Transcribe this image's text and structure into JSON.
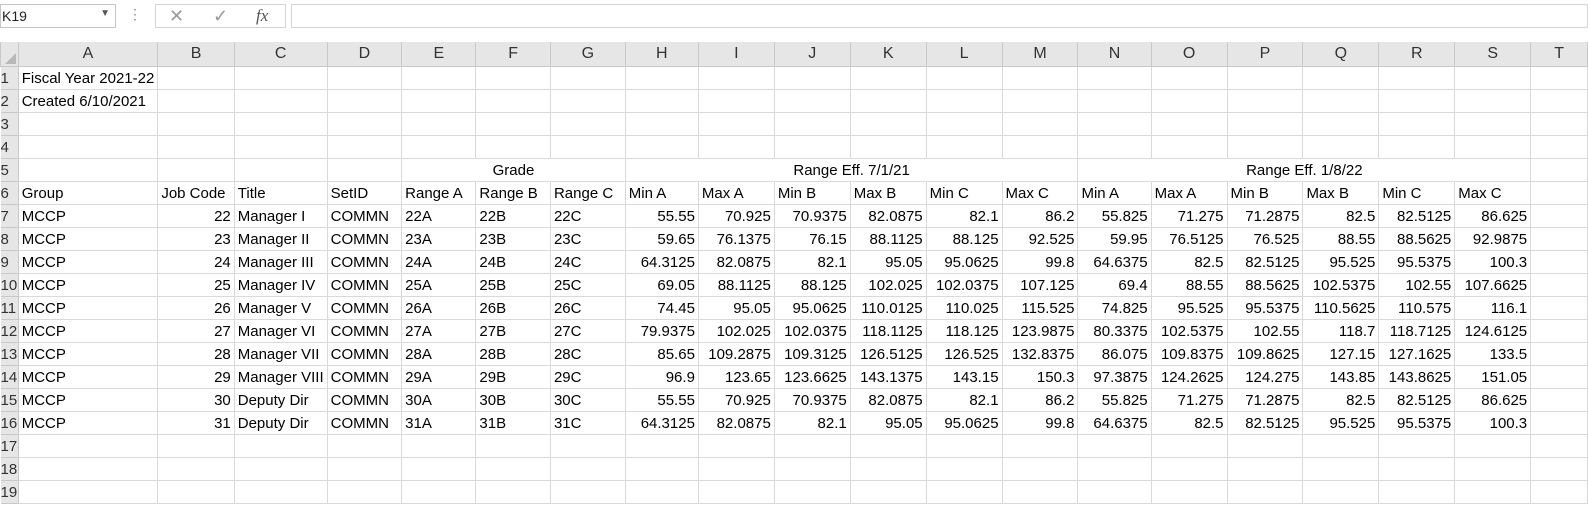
{
  "formula_bar": {
    "name_box": "K19",
    "cancel_glyph": "✕",
    "enter_glyph": "✓",
    "fx_label": "fx",
    "formula_value": ""
  },
  "columns": [
    "A",
    "B",
    "C",
    "D",
    "E",
    "F",
    "G",
    "H",
    "I",
    "J",
    "K",
    "L",
    "M",
    "N",
    "O",
    "P",
    "Q",
    "R",
    "S",
    "T"
  ],
  "rows": [
    {
      "num": "1",
      "cells": [
        {
          "col": "A",
          "text": "Fiscal Year 2021-22"
        }
      ]
    },
    {
      "num": "2",
      "cells": [
        {
          "col": "A",
          "text": "Created 6/10/2021"
        }
      ]
    },
    {
      "num": "3",
      "cells": []
    },
    {
      "num": "4",
      "cells": []
    },
    {
      "num": "5",
      "cells": [
        {
          "col": "E",
          "text": "Grade",
          "span": 3,
          "align": "ctr"
        },
        {
          "col": "H",
          "text": "Range Eff. 7/1/21",
          "span": 6,
          "align": "ctr"
        },
        {
          "col": "N",
          "text": "Range Eff. 1/8/22",
          "span": 6,
          "align": "ctr"
        }
      ]
    },
    {
      "num": "6",
      "cells": [
        {
          "col": "A",
          "text": "Group"
        },
        {
          "col": "B",
          "text": "Job Code"
        },
        {
          "col": "C",
          "text": "Title"
        },
        {
          "col": "D",
          "text": "SetID"
        },
        {
          "col": "E",
          "text": "Range A"
        },
        {
          "col": "F",
          "text": "Range B"
        },
        {
          "col": "G",
          "text": "Range C"
        },
        {
          "col": "H",
          "text": "Min A"
        },
        {
          "col": "I",
          "text": "Max A"
        },
        {
          "col": "J",
          "text": "Min B"
        },
        {
          "col": "K",
          "text": "Max B"
        },
        {
          "col": "L",
          "text": "Min C"
        },
        {
          "col": "M",
          "text": "Max C"
        },
        {
          "col": "N",
          "text": "Min A"
        },
        {
          "col": "O",
          "text": "Max A"
        },
        {
          "col": "P",
          "text": "Min B"
        },
        {
          "col": "Q",
          "text": "Max B"
        },
        {
          "col": "R",
          "text": "Min C"
        },
        {
          "col": "S",
          "text": "Max C"
        }
      ]
    },
    {
      "num": "7",
      "cells": [
        {
          "col": "A",
          "text": "MCCP"
        },
        {
          "col": "B",
          "text": "22",
          "align": "num"
        },
        {
          "col": "C",
          "text": "Manager I"
        },
        {
          "col": "D",
          "text": "COMMN"
        },
        {
          "col": "E",
          "text": "22A"
        },
        {
          "col": "F",
          "text": "22B"
        },
        {
          "col": "G",
          "text": "22C"
        },
        {
          "col": "H",
          "text": "55.55",
          "align": "num"
        },
        {
          "col": "I",
          "text": "70.925",
          "align": "num"
        },
        {
          "col": "J",
          "text": "70.9375",
          "align": "num"
        },
        {
          "col": "K",
          "text": "82.0875",
          "align": "num"
        },
        {
          "col": "L",
          "text": "82.1",
          "align": "num"
        },
        {
          "col": "M",
          "text": "86.2",
          "align": "num"
        },
        {
          "col": "N",
          "text": "55.825",
          "align": "num"
        },
        {
          "col": "O",
          "text": "71.275",
          "align": "num"
        },
        {
          "col": "P",
          "text": "71.2875",
          "align": "num"
        },
        {
          "col": "Q",
          "text": "82.5",
          "align": "num"
        },
        {
          "col": "R",
          "text": "82.5125",
          "align": "num"
        },
        {
          "col": "S",
          "text": "86.625",
          "align": "num"
        }
      ]
    },
    {
      "num": "8",
      "cells": [
        {
          "col": "A",
          "text": "MCCP"
        },
        {
          "col": "B",
          "text": "23",
          "align": "num"
        },
        {
          "col": "C",
          "text": "Manager II"
        },
        {
          "col": "D",
          "text": "COMMN"
        },
        {
          "col": "E",
          "text": "23A"
        },
        {
          "col": "F",
          "text": "23B"
        },
        {
          "col": "G",
          "text": "23C"
        },
        {
          "col": "H",
          "text": "59.65",
          "align": "num"
        },
        {
          "col": "I",
          "text": "76.1375",
          "align": "num"
        },
        {
          "col": "J",
          "text": "76.15",
          "align": "num"
        },
        {
          "col": "K",
          "text": "88.1125",
          "align": "num"
        },
        {
          "col": "L",
          "text": "88.125",
          "align": "num"
        },
        {
          "col": "M",
          "text": "92.525",
          "align": "num"
        },
        {
          "col": "N",
          "text": "59.95",
          "align": "num"
        },
        {
          "col": "O",
          "text": "76.5125",
          "align": "num"
        },
        {
          "col": "P",
          "text": "76.525",
          "align": "num"
        },
        {
          "col": "Q",
          "text": "88.55",
          "align": "num"
        },
        {
          "col": "R",
          "text": "88.5625",
          "align": "num"
        },
        {
          "col": "S",
          "text": "92.9875",
          "align": "num"
        }
      ]
    },
    {
      "num": "9",
      "cells": [
        {
          "col": "A",
          "text": "MCCP"
        },
        {
          "col": "B",
          "text": "24",
          "align": "num"
        },
        {
          "col": "C",
          "text": "Manager III"
        },
        {
          "col": "D",
          "text": "COMMN"
        },
        {
          "col": "E",
          "text": "24A"
        },
        {
          "col": "F",
          "text": "24B"
        },
        {
          "col": "G",
          "text": "24C"
        },
        {
          "col": "H",
          "text": "64.3125",
          "align": "num"
        },
        {
          "col": "I",
          "text": "82.0875",
          "align": "num"
        },
        {
          "col": "J",
          "text": "82.1",
          "align": "num"
        },
        {
          "col": "K",
          "text": "95.05",
          "align": "num"
        },
        {
          "col": "L",
          "text": "95.0625",
          "align": "num"
        },
        {
          "col": "M",
          "text": "99.8",
          "align": "num"
        },
        {
          "col": "N",
          "text": "64.6375",
          "align": "num"
        },
        {
          "col": "O",
          "text": "82.5",
          "align": "num"
        },
        {
          "col": "P",
          "text": "82.5125",
          "align": "num"
        },
        {
          "col": "Q",
          "text": "95.525",
          "align": "num"
        },
        {
          "col": "R",
          "text": "95.5375",
          "align": "num"
        },
        {
          "col": "S",
          "text": "100.3",
          "align": "num"
        }
      ]
    },
    {
      "num": "10",
      "cells": [
        {
          "col": "A",
          "text": "MCCP"
        },
        {
          "col": "B",
          "text": "25",
          "align": "num"
        },
        {
          "col": "C",
          "text": "Manager IV"
        },
        {
          "col": "D",
          "text": "COMMN"
        },
        {
          "col": "E",
          "text": "25A"
        },
        {
          "col": "F",
          "text": "25B"
        },
        {
          "col": "G",
          "text": "25C"
        },
        {
          "col": "H",
          "text": "69.05",
          "align": "num"
        },
        {
          "col": "I",
          "text": "88.1125",
          "align": "num"
        },
        {
          "col": "J",
          "text": "88.125",
          "align": "num"
        },
        {
          "col": "K",
          "text": "102.025",
          "align": "num"
        },
        {
          "col": "L",
          "text": "102.0375",
          "align": "num"
        },
        {
          "col": "M",
          "text": "107.125",
          "align": "num"
        },
        {
          "col": "N",
          "text": "69.4",
          "align": "num"
        },
        {
          "col": "O",
          "text": "88.55",
          "align": "num"
        },
        {
          "col": "P",
          "text": "88.5625",
          "align": "num"
        },
        {
          "col": "Q",
          "text": "102.5375",
          "align": "num"
        },
        {
          "col": "R",
          "text": "102.55",
          "align": "num"
        },
        {
          "col": "S",
          "text": "107.6625",
          "align": "num"
        }
      ]
    },
    {
      "num": "11",
      "cells": [
        {
          "col": "A",
          "text": "MCCP"
        },
        {
          "col": "B",
          "text": "26",
          "align": "num"
        },
        {
          "col": "C",
          "text": "Manager V"
        },
        {
          "col": "D",
          "text": "COMMN"
        },
        {
          "col": "E",
          "text": "26A"
        },
        {
          "col": "F",
          "text": "26B"
        },
        {
          "col": "G",
          "text": "26C"
        },
        {
          "col": "H",
          "text": "74.45",
          "align": "num"
        },
        {
          "col": "I",
          "text": "95.05",
          "align": "num"
        },
        {
          "col": "J",
          "text": "95.0625",
          "align": "num"
        },
        {
          "col": "K",
          "text": "110.0125",
          "align": "num"
        },
        {
          "col": "L",
          "text": "110.025",
          "align": "num"
        },
        {
          "col": "M",
          "text": "115.525",
          "align": "num"
        },
        {
          "col": "N",
          "text": "74.825",
          "align": "num"
        },
        {
          "col": "O",
          "text": "95.525",
          "align": "num"
        },
        {
          "col": "P",
          "text": "95.5375",
          "align": "num"
        },
        {
          "col": "Q",
          "text": "110.5625",
          "align": "num"
        },
        {
          "col": "R",
          "text": "110.575",
          "align": "num"
        },
        {
          "col": "S",
          "text": "116.1",
          "align": "num"
        }
      ]
    },
    {
      "num": "12",
      "cells": [
        {
          "col": "A",
          "text": "MCCP"
        },
        {
          "col": "B",
          "text": "27",
          "align": "num"
        },
        {
          "col": "C",
          "text": "Manager VI"
        },
        {
          "col": "D",
          "text": "COMMN"
        },
        {
          "col": "E",
          "text": "27A"
        },
        {
          "col": "F",
          "text": "27B"
        },
        {
          "col": "G",
          "text": "27C"
        },
        {
          "col": "H",
          "text": "79.9375",
          "align": "num"
        },
        {
          "col": "I",
          "text": "102.025",
          "align": "num"
        },
        {
          "col": "J",
          "text": "102.0375",
          "align": "num"
        },
        {
          "col": "K",
          "text": "118.1125",
          "align": "num"
        },
        {
          "col": "L",
          "text": "118.125",
          "align": "num"
        },
        {
          "col": "M",
          "text": "123.9875",
          "align": "num"
        },
        {
          "col": "N",
          "text": "80.3375",
          "align": "num"
        },
        {
          "col": "O",
          "text": "102.5375",
          "align": "num"
        },
        {
          "col": "P",
          "text": "102.55",
          "align": "num"
        },
        {
          "col": "Q",
          "text": "118.7",
          "align": "num"
        },
        {
          "col": "R",
          "text": "118.7125",
          "align": "num"
        },
        {
          "col": "S",
          "text": "124.6125",
          "align": "num"
        }
      ]
    },
    {
      "num": "13",
      "cells": [
        {
          "col": "A",
          "text": "MCCP"
        },
        {
          "col": "B",
          "text": "28",
          "align": "num"
        },
        {
          "col": "C",
          "text": "Manager VII"
        },
        {
          "col": "D",
          "text": "COMMN"
        },
        {
          "col": "E",
          "text": "28A"
        },
        {
          "col": "F",
          "text": "28B"
        },
        {
          "col": "G",
          "text": "28C"
        },
        {
          "col": "H",
          "text": "85.65",
          "align": "num"
        },
        {
          "col": "I",
          "text": "109.2875",
          "align": "num"
        },
        {
          "col": "J",
          "text": "109.3125",
          "align": "num"
        },
        {
          "col": "K",
          "text": "126.5125",
          "align": "num"
        },
        {
          "col": "L",
          "text": "126.525",
          "align": "num"
        },
        {
          "col": "M",
          "text": "132.8375",
          "align": "num"
        },
        {
          "col": "N",
          "text": "86.075",
          "align": "num"
        },
        {
          "col": "O",
          "text": "109.8375",
          "align": "num"
        },
        {
          "col": "P",
          "text": "109.8625",
          "align": "num"
        },
        {
          "col": "Q",
          "text": "127.15",
          "align": "num"
        },
        {
          "col": "R",
          "text": "127.1625",
          "align": "num"
        },
        {
          "col": "S",
          "text": "133.5",
          "align": "num"
        }
      ]
    },
    {
      "num": "14",
      "cells": [
        {
          "col": "A",
          "text": "MCCP"
        },
        {
          "col": "B",
          "text": "29",
          "align": "num"
        },
        {
          "col": "C",
          "text": "Manager VIII"
        },
        {
          "col": "D",
          "text": "COMMN"
        },
        {
          "col": "E",
          "text": "29A"
        },
        {
          "col": "F",
          "text": "29B"
        },
        {
          "col": "G",
          "text": "29C"
        },
        {
          "col": "H",
          "text": "96.9",
          "align": "num"
        },
        {
          "col": "I",
          "text": "123.65",
          "align": "num"
        },
        {
          "col": "J",
          "text": "123.6625",
          "align": "num"
        },
        {
          "col": "K",
          "text": "143.1375",
          "align": "num"
        },
        {
          "col": "L",
          "text": "143.15",
          "align": "num"
        },
        {
          "col": "M",
          "text": "150.3",
          "align": "num"
        },
        {
          "col": "N",
          "text": "97.3875",
          "align": "num"
        },
        {
          "col": "O",
          "text": "124.2625",
          "align": "num"
        },
        {
          "col": "P",
          "text": "124.275",
          "align": "num"
        },
        {
          "col": "Q",
          "text": "143.85",
          "align": "num"
        },
        {
          "col": "R",
          "text": "143.8625",
          "align": "num"
        },
        {
          "col": "S",
          "text": "151.05",
          "align": "num"
        }
      ]
    },
    {
      "num": "15",
      "cells": [
        {
          "col": "A",
          "text": "MCCP"
        },
        {
          "col": "B",
          "text": "30",
          "align": "num"
        },
        {
          "col": "C",
          "text": "Deputy Dir"
        },
        {
          "col": "D",
          "text": "COMMN"
        },
        {
          "col": "E",
          "text": "30A"
        },
        {
          "col": "F",
          "text": "30B"
        },
        {
          "col": "G",
          "text": "30C"
        },
        {
          "col": "H",
          "text": "55.55",
          "align": "num"
        },
        {
          "col": "I",
          "text": "70.925",
          "align": "num"
        },
        {
          "col": "J",
          "text": "70.9375",
          "align": "num"
        },
        {
          "col": "K",
          "text": "82.0875",
          "align": "num"
        },
        {
          "col": "L",
          "text": "82.1",
          "align": "num"
        },
        {
          "col": "M",
          "text": "86.2",
          "align": "num"
        },
        {
          "col": "N",
          "text": "55.825",
          "align": "num"
        },
        {
          "col": "O",
          "text": "71.275",
          "align": "num"
        },
        {
          "col": "P",
          "text": "71.2875",
          "align": "num"
        },
        {
          "col": "Q",
          "text": "82.5",
          "align": "num"
        },
        {
          "col": "R",
          "text": "82.5125",
          "align": "num"
        },
        {
          "col": "S",
          "text": "86.625",
          "align": "num"
        }
      ]
    },
    {
      "num": "16",
      "cells": [
        {
          "col": "A",
          "text": "MCCP"
        },
        {
          "col": "B",
          "text": "31",
          "align": "num"
        },
        {
          "col": "C",
          "text": "Deputy Dir"
        },
        {
          "col": "D",
          "text": "COMMN"
        },
        {
          "col": "E",
          "text": "31A"
        },
        {
          "col": "F",
          "text": "31B"
        },
        {
          "col": "G",
          "text": "31C"
        },
        {
          "col": "H",
          "text": "64.3125",
          "align": "num"
        },
        {
          "col": "I",
          "text": "82.0875",
          "align": "num"
        },
        {
          "col": "J",
          "text": "82.1",
          "align": "num"
        },
        {
          "col": "K",
          "text": "95.05",
          "align": "num"
        },
        {
          "col": "L",
          "text": "95.0625",
          "align": "num"
        },
        {
          "col": "M",
          "text": "99.8",
          "align": "num"
        },
        {
          "col": "N",
          "text": "64.6375",
          "align": "num"
        },
        {
          "col": "O",
          "text": "82.5",
          "align": "num"
        },
        {
          "col": "P",
          "text": "82.5125",
          "align": "num"
        },
        {
          "col": "Q",
          "text": "95.525",
          "align": "num"
        },
        {
          "col": "R",
          "text": "95.5375",
          "align": "num"
        },
        {
          "col": "S",
          "text": "100.3",
          "align": "num"
        }
      ]
    },
    {
      "num": "17",
      "cells": []
    },
    {
      "num": "18",
      "cells": []
    },
    {
      "num": "19",
      "cells": []
    }
  ]
}
